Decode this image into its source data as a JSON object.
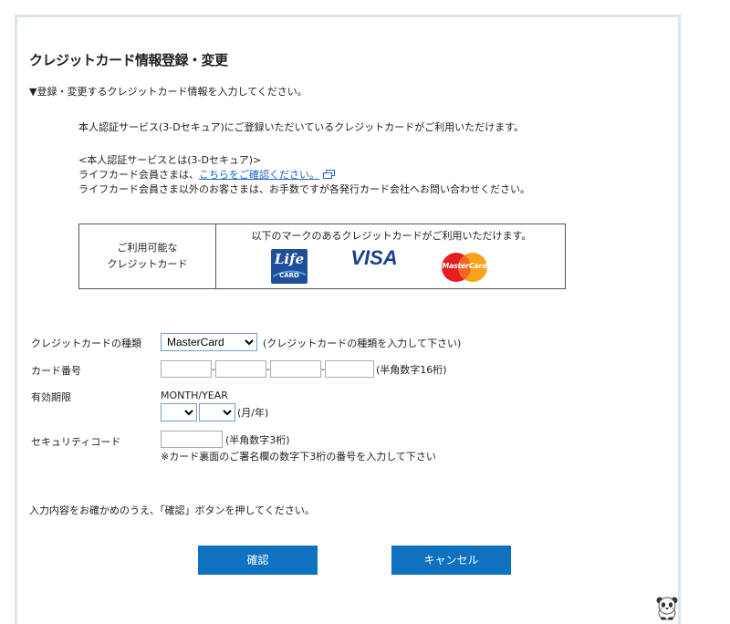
{
  "page": {
    "title": "クレジットカード情報登録・変更",
    "instruction": "▼登録・変更するクレジットカード情報を入力してください。"
  },
  "notes": {
    "line1": "本人認証サービス(3-Dセキュア)にご登録いただいているクレジットカードがご利用いただけます。",
    "about_heading": "<本人認証サービスとは(3-Dセキュア)>",
    "life_prefix": "ライフカード会員さまは、",
    "life_link": "こちらをご確認ください。",
    "others": "ライフカード会員さま以外のお客さまは、お手数ですが各発行カード会社へお問い合わせください。"
  },
  "card_table": {
    "label_line1": "ご利用可能な",
    "label_line2": "クレジットカード",
    "message": "以下のマークのあるクレジットカードがご利用いただけます。",
    "logos": {
      "life_top": "Life",
      "life_bottom": "CARD",
      "visa": "VISA",
      "mastercard": "MasterCard"
    }
  },
  "form": {
    "card_type": {
      "label": "クレジットカードの種類",
      "selected": "MasterCard",
      "hint": "(クレジットカードの種類を入力して下さい)"
    },
    "card_number": {
      "label": "カード番号",
      "separator": "-",
      "hint": "(半角数字16桁)"
    },
    "expiry": {
      "label": "有効期限",
      "caption": "MONTH/YEAR",
      "month": "",
      "year": "",
      "hint": "(月/年)"
    },
    "security_code": {
      "label": "セキュリティコード",
      "hint": "(半角数字3桁)",
      "note": "※カード裏面のご署名欄の数字下3桁の番号を入力して下さい"
    }
  },
  "confirm_text": "入力内容をお確かめのうえ、「確認」ボタンを押してください。",
  "buttons": {
    "confirm": "確認",
    "cancel": "キャンセル"
  },
  "colors": {
    "button_bg": "#0f72c0",
    "link": "#1a63c6",
    "frame_border": "#d9e6f2"
  },
  "icons": {
    "external_link": "external-window-icon",
    "mascot": "panda-mascot-icon"
  }
}
